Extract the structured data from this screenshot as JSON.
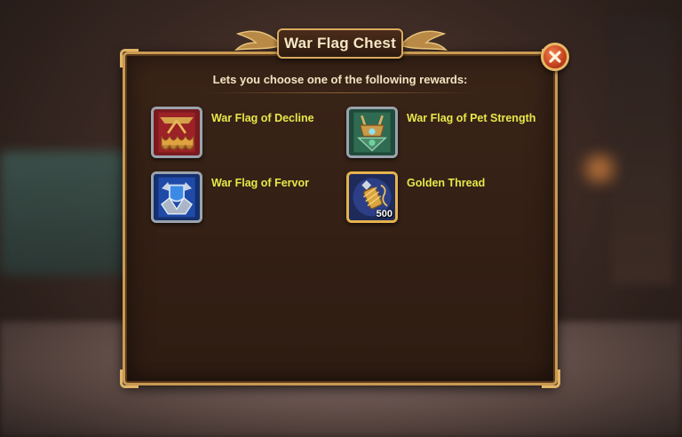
{
  "dialog": {
    "title": "War Flag Chest",
    "subtitle": "Lets you choose one of the following rewards:",
    "close_icon": "close-x-icon"
  },
  "rewards": [
    {
      "label": "War Flag of Decline",
      "icon": "war-flag-decline-icon",
      "color": "#8b1e22"
    },
    {
      "label": "War Flag of Pet Strength",
      "icon": "war-flag-pet-strength-icon",
      "color": "#2f6b52"
    },
    {
      "label": "War Flag of Fervor",
      "icon": "war-flag-fervor-icon",
      "color": "#1f4aa8"
    },
    {
      "label": "Golden Thread",
      "icon": "golden-thread-icon",
      "quantity": "500",
      "color": "#d9a441"
    }
  ],
  "colors": {
    "label_yellow": "#e8e84a",
    "frame_gold": "#c99a52",
    "close_red": "#c2401d"
  }
}
